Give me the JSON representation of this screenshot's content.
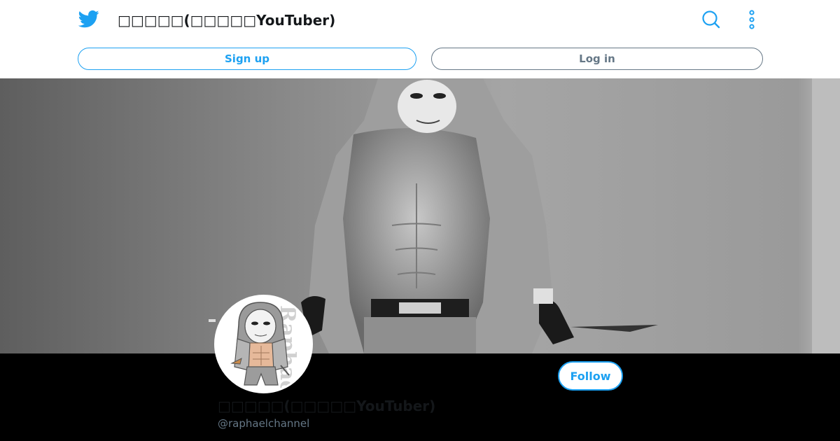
{
  "header": {
    "title": "□□□□□(□□□□□YouTuber)",
    "logo_icon": "twitter-bird-icon",
    "search_icon": "search-icon",
    "more_icon": "more-vertical-icon",
    "signup_label": "Sign up",
    "login_label": "Log in"
  },
  "profile": {
    "display_name": "□□□□□(□□□□□YouTuber)",
    "handle": "@raphaelchannel",
    "follow_label": "Follow",
    "avatar_watermark": "Raphael"
  },
  "colors": {
    "accent": "#1da1f2",
    "muted": "#657786",
    "name": "#14171a"
  }
}
